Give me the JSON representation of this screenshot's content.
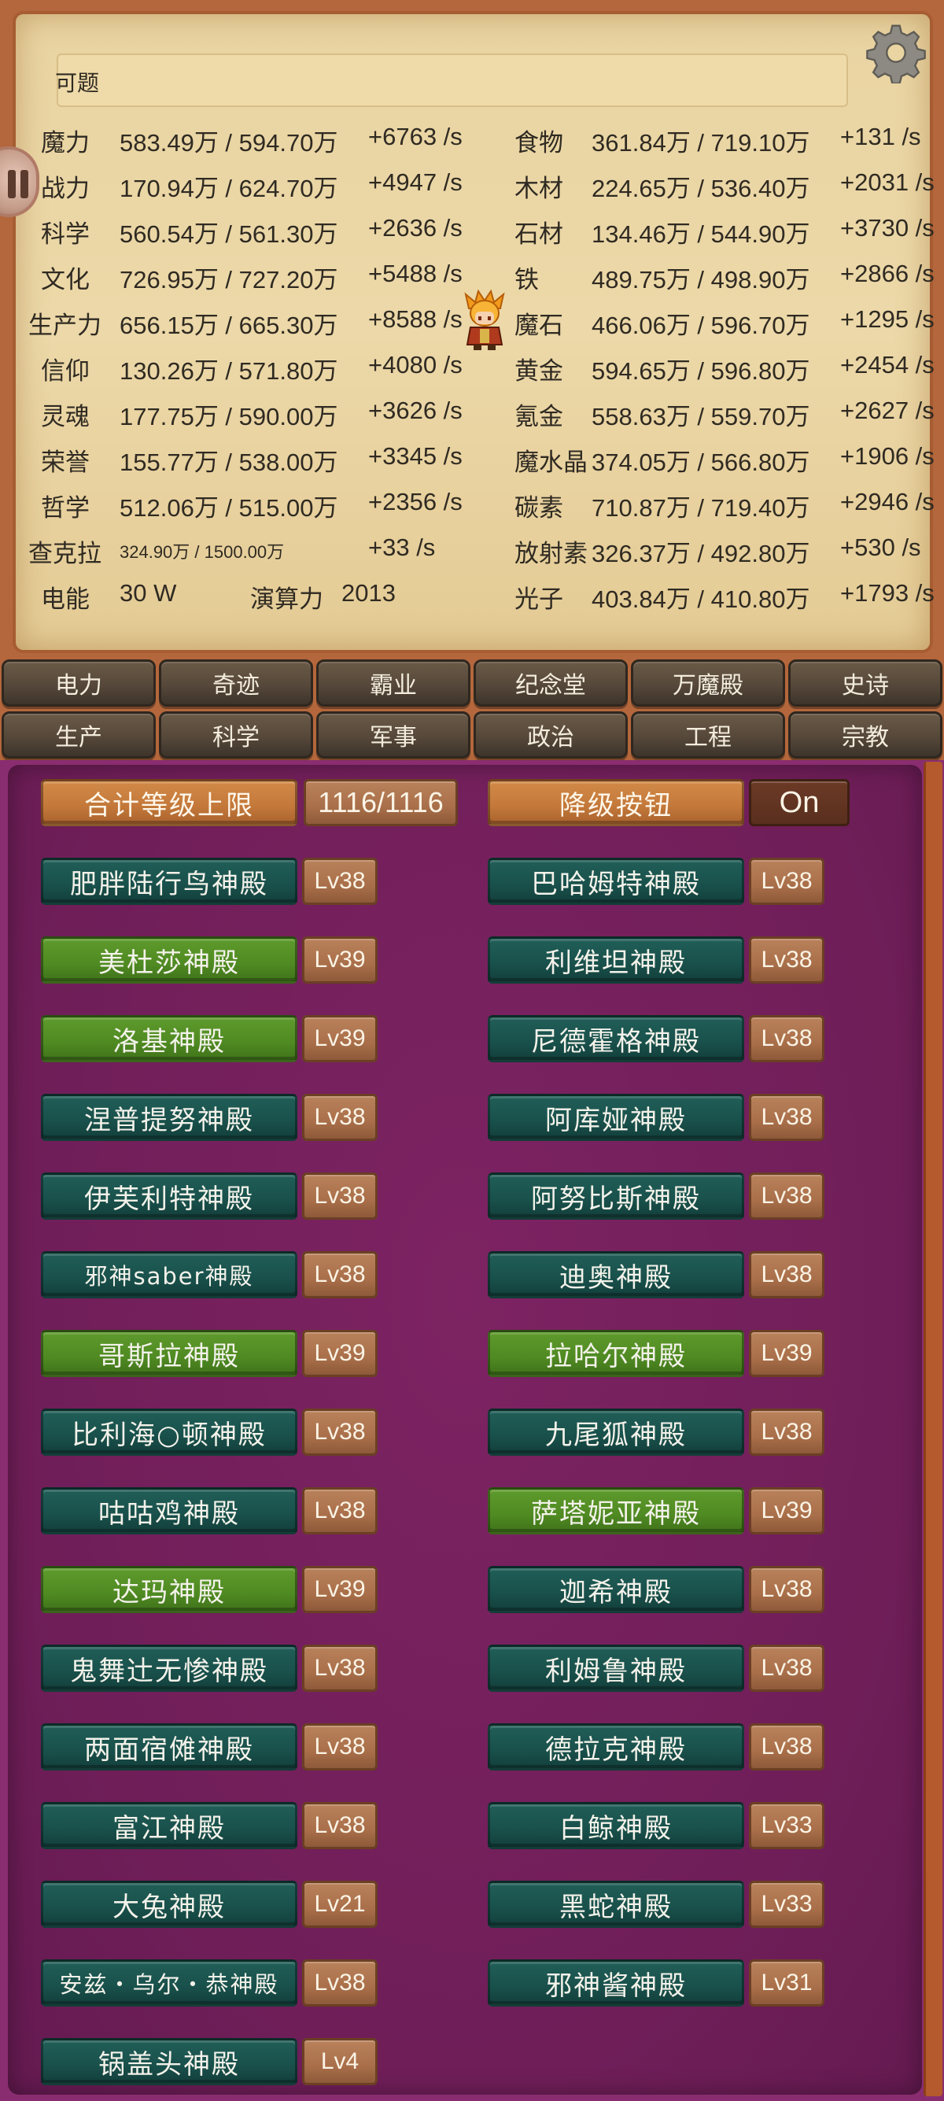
{
  "question": "可题",
  "resources": [
    {
      "name": "魔力",
      "value": "583.49万 / 594.70万",
      "rate": "+6763 /s",
      "name2": "食物",
      "value2": "361.84万 / 719.10万",
      "rate2": "+131 /s"
    },
    {
      "name": "战力",
      "value": "170.94万 / 624.70万",
      "rate": "+4947 /s",
      "name2": "木材",
      "value2": "224.65万 / 536.40万",
      "rate2": "+2031 /s"
    },
    {
      "name": "科学",
      "value": "560.54万 / 561.30万",
      "rate": "+2636 /s",
      "name2": "石材",
      "value2": "134.46万 / 544.90万",
      "rate2": "+3730 /s"
    },
    {
      "name": "文化",
      "value": "726.95万 / 727.20万",
      "rate": "+5488 /s",
      "name2": "铁",
      "value2": "489.75万 / 498.90万",
      "rate2": "+2866 /s"
    },
    {
      "name": "生产力",
      "value": "656.15万 / 665.30万",
      "rate": "+8588 /s",
      "name2": "魔石",
      "value2": "466.06万 / 596.70万",
      "rate2": "+1295 /s"
    },
    {
      "name": "信仰",
      "value": "130.26万 / 571.80万",
      "rate": "+4080 /s",
      "name2": "黄金",
      "value2": "594.65万 / 596.80万",
      "rate2": "+2454 /s"
    },
    {
      "name": "灵魂",
      "value": "177.75万 / 590.00万",
      "rate": "+3626 /s",
      "name2": "氪金",
      "value2": "558.63万 / 559.70万",
      "rate2": "+2627 /s"
    },
    {
      "name": "荣誉",
      "value": "155.77万 / 538.00万",
      "rate": "+3345 /s",
      "name2": "魔水晶",
      "value2": "374.05万 / 566.80万",
      "rate2": "+1906 /s"
    },
    {
      "name": "哲学",
      "value": "512.06万 / 515.00万",
      "rate": "+2356 /s",
      "name2": "碳素",
      "value2": "710.87万 / 719.40万",
      "rate2": "+2946 /s"
    },
    {
      "name": "查克拉",
      "value": "324.90万 / 1500.00万",
      "rate": "+33 /s",
      "name2": "放射素",
      "value2": "326.37万 / 492.80万",
      "rate2": "+530 /s"
    }
  ],
  "power": {
    "name": "电能",
    "value": "30 W",
    "compute_label": "演算力",
    "compute_value": "2013",
    "name2": "光子",
    "value2": "403.84万 / 410.80万",
    "rate2": "+1793 /s"
  },
  "tabs_row1": [
    "电力",
    "奇迹",
    "霸业",
    "纪念堂",
    "万魔殿",
    "史诗"
  ],
  "tabs_row2": [
    "生产",
    "科学",
    "军事",
    "政治",
    "工程",
    "宗教"
  ],
  "header": {
    "total_label": "合计等级上限",
    "total_value": "1116/1116",
    "downgrade_label": "降级按钮",
    "downgrade_value": "On"
  },
  "temples_left": [
    {
      "name": "肥胖陆行鸟神殿",
      "level": "Lv38",
      "color": "teal"
    },
    {
      "name": "美杜莎神殿",
      "level": "Lv39",
      "color": "green"
    },
    {
      "name": "洛基神殿",
      "level": "Lv39",
      "color": "green"
    },
    {
      "name": "涅普提努神殿",
      "level": "Lv38",
      "color": "teal"
    },
    {
      "name": "伊芙利特神殿",
      "level": "Lv38",
      "color": "teal"
    },
    {
      "name": "邪神saber神殿",
      "level": "Lv38",
      "color": "teal"
    },
    {
      "name": "哥斯拉神殿",
      "level": "Lv39",
      "color": "green"
    },
    {
      "name": "比利海○顿神殿",
      "level": "Lv38",
      "color": "teal"
    },
    {
      "name": "咕咕鸡神殿",
      "level": "Lv38",
      "color": "teal"
    },
    {
      "name": "达玛神殿",
      "level": "Lv39",
      "color": "green"
    },
    {
      "name": "鬼舞辻无惨神殿",
      "level": "Lv38",
      "color": "teal"
    },
    {
      "name": "两面宿傩神殿",
      "level": "Lv38",
      "color": "teal"
    },
    {
      "name": "富江神殿",
      "level": "Lv38",
      "color": "teal"
    },
    {
      "name": "大兔神殿",
      "level": "Lv21",
      "color": "teal"
    },
    {
      "name": "安兹・乌尔・恭神殿",
      "level": "Lv38",
      "color": "teal"
    },
    {
      "name": "锅盖头神殿",
      "level": "Lv4",
      "color": "teal"
    }
  ],
  "temples_right": [
    {
      "name": "巴哈姆特神殿",
      "level": "Lv38",
      "color": "teal"
    },
    {
      "name": "利维坦神殿",
      "level": "Lv38",
      "color": "teal"
    },
    {
      "name": "尼德霍格神殿",
      "level": "Lv38",
      "color": "teal"
    },
    {
      "name": "阿库娅神殿",
      "level": "Lv38",
      "color": "teal"
    },
    {
      "name": "阿努比斯神殿",
      "level": "Lv38",
      "color": "teal"
    },
    {
      "name": "迪奥神殿",
      "level": "Lv38",
      "color": "teal"
    },
    {
      "name": "拉哈尔神殿",
      "level": "Lv39",
      "color": "green"
    },
    {
      "name": "九尾狐神殿",
      "level": "Lv38",
      "color": "teal"
    },
    {
      "name": "萨塔妮亚神殿",
      "level": "Lv39",
      "color": "green"
    },
    {
      "name": "迦希神殿",
      "level": "Lv38",
      "color": "teal"
    },
    {
      "name": "利姆鲁神殿",
      "level": "Lv38",
      "color": "teal"
    },
    {
      "name": "德拉克神殿",
      "level": "Lv38",
      "color": "teal"
    },
    {
      "name": "白鲸神殿",
      "level": "Lv33",
      "color": "teal"
    },
    {
      "name": "黑蛇神殿",
      "level": "Lv33",
      "color": "teal"
    },
    {
      "name": "邪神酱神殿",
      "level": "Lv31",
      "color": "teal"
    }
  ],
  "colors": {
    "frame": "#b4673c",
    "parchment": "#ecd8a8",
    "purple": "#7d2363",
    "teal": "#19504b",
    "green": "#4f8a22",
    "orange": "#c3783a",
    "level": "#a96f4a"
  },
  "icons": {
    "settings": "gear-icon",
    "side_tab": "pause-icon",
    "hero": "hero-avatar"
  }
}
